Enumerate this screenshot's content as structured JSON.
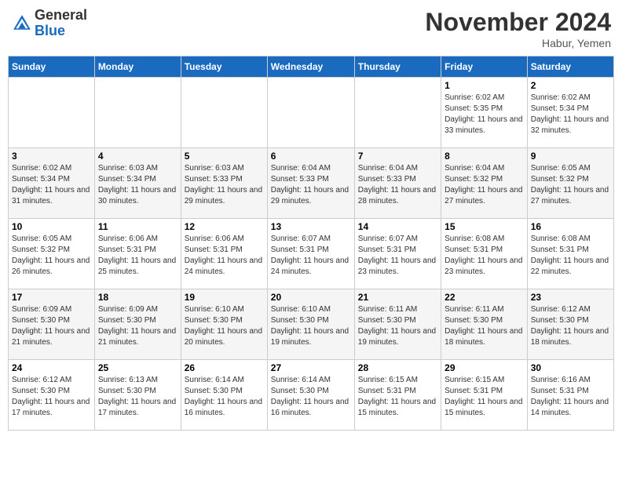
{
  "logo": {
    "general": "General",
    "blue": "Blue"
  },
  "header": {
    "month": "November 2024",
    "location": "Habur, Yemen"
  },
  "weekdays": [
    "Sunday",
    "Monday",
    "Tuesday",
    "Wednesday",
    "Thursday",
    "Friday",
    "Saturday"
  ],
  "weeks": [
    [
      {
        "day": "",
        "info": ""
      },
      {
        "day": "",
        "info": ""
      },
      {
        "day": "",
        "info": ""
      },
      {
        "day": "",
        "info": ""
      },
      {
        "day": "",
        "info": ""
      },
      {
        "day": "1",
        "info": "Sunrise: 6:02 AM\nSunset: 5:35 PM\nDaylight: 11 hours and 33 minutes."
      },
      {
        "day": "2",
        "info": "Sunrise: 6:02 AM\nSunset: 5:34 PM\nDaylight: 11 hours and 32 minutes."
      }
    ],
    [
      {
        "day": "3",
        "info": "Sunrise: 6:02 AM\nSunset: 5:34 PM\nDaylight: 11 hours and 31 minutes."
      },
      {
        "day": "4",
        "info": "Sunrise: 6:03 AM\nSunset: 5:34 PM\nDaylight: 11 hours and 30 minutes."
      },
      {
        "day": "5",
        "info": "Sunrise: 6:03 AM\nSunset: 5:33 PM\nDaylight: 11 hours and 29 minutes."
      },
      {
        "day": "6",
        "info": "Sunrise: 6:04 AM\nSunset: 5:33 PM\nDaylight: 11 hours and 29 minutes."
      },
      {
        "day": "7",
        "info": "Sunrise: 6:04 AM\nSunset: 5:33 PM\nDaylight: 11 hours and 28 minutes."
      },
      {
        "day": "8",
        "info": "Sunrise: 6:04 AM\nSunset: 5:32 PM\nDaylight: 11 hours and 27 minutes."
      },
      {
        "day": "9",
        "info": "Sunrise: 6:05 AM\nSunset: 5:32 PM\nDaylight: 11 hours and 27 minutes."
      }
    ],
    [
      {
        "day": "10",
        "info": "Sunrise: 6:05 AM\nSunset: 5:32 PM\nDaylight: 11 hours and 26 minutes."
      },
      {
        "day": "11",
        "info": "Sunrise: 6:06 AM\nSunset: 5:31 PM\nDaylight: 11 hours and 25 minutes."
      },
      {
        "day": "12",
        "info": "Sunrise: 6:06 AM\nSunset: 5:31 PM\nDaylight: 11 hours and 24 minutes."
      },
      {
        "day": "13",
        "info": "Sunrise: 6:07 AM\nSunset: 5:31 PM\nDaylight: 11 hours and 24 minutes."
      },
      {
        "day": "14",
        "info": "Sunrise: 6:07 AM\nSunset: 5:31 PM\nDaylight: 11 hours and 23 minutes."
      },
      {
        "day": "15",
        "info": "Sunrise: 6:08 AM\nSunset: 5:31 PM\nDaylight: 11 hours and 23 minutes."
      },
      {
        "day": "16",
        "info": "Sunrise: 6:08 AM\nSunset: 5:31 PM\nDaylight: 11 hours and 22 minutes."
      }
    ],
    [
      {
        "day": "17",
        "info": "Sunrise: 6:09 AM\nSunset: 5:30 PM\nDaylight: 11 hours and 21 minutes."
      },
      {
        "day": "18",
        "info": "Sunrise: 6:09 AM\nSunset: 5:30 PM\nDaylight: 11 hours and 21 minutes."
      },
      {
        "day": "19",
        "info": "Sunrise: 6:10 AM\nSunset: 5:30 PM\nDaylight: 11 hours and 20 minutes."
      },
      {
        "day": "20",
        "info": "Sunrise: 6:10 AM\nSunset: 5:30 PM\nDaylight: 11 hours and 19 minutes."
      },
      {
        "day": "21",
        "info": "Sunrise: 6:11 AM\nSunset: 5:30 PM\nDaylight: 11 hours and 19 minutes."
      },
      {
        "day": "22",
        "info": "Sunrise: 6:11 AM\nSunset: 5:30 PM\nDaylight: 11 hours and 18 minutes."
      },
      {
        "day": "23",
        "info": "Sunrise: 6:12 AM\nSunset: 5:30 PM\nDaylight: 11 hours and 18 minutes."
      }
    ],
    [
      {
        "day": "24",
        "info": "Sunrise: 6:12 AM\nSunset: 5:30 PM\nDaylight: 11 hours and 17 minutes."
      },
      {
        "day": "25",
        "info": "Sunrise: 6:13 AM\nSunset: 5:30 PM\nDaylight: 11 hours and 17 minutes."
      },
      {
        "day": "26",
        "info": "Sunrise: 6:14 AM\nSunset: 5:30 PM\nDaylight: 11 hours and 16 minutes."
      },
      {
        "day": "27",
        "info": "Sunrise: 6:14 AM\nSunset: 5:30 PM\nDaylight: 11 hours and 16 minutes."
      },
      {
        "day": "28",
        "info": "Sunrise: 6:15 AM\nSunset: 5:31 PM\nDaylight: 11 hours and 15 minutes."
      },
      {
        "day": "29",
        "info": "Sunrise: 6:15 AM\nSunset: 5:31 PM\nDaylight: 11 hours and 15 minutes."
      },
      {
        "day": "30",
        "info": "Sunrise: 6:16 AM\nSunset: 5:31 PM\nDaylight: 11 hours and 14 minutes."
      }
    ]
  ]
}
